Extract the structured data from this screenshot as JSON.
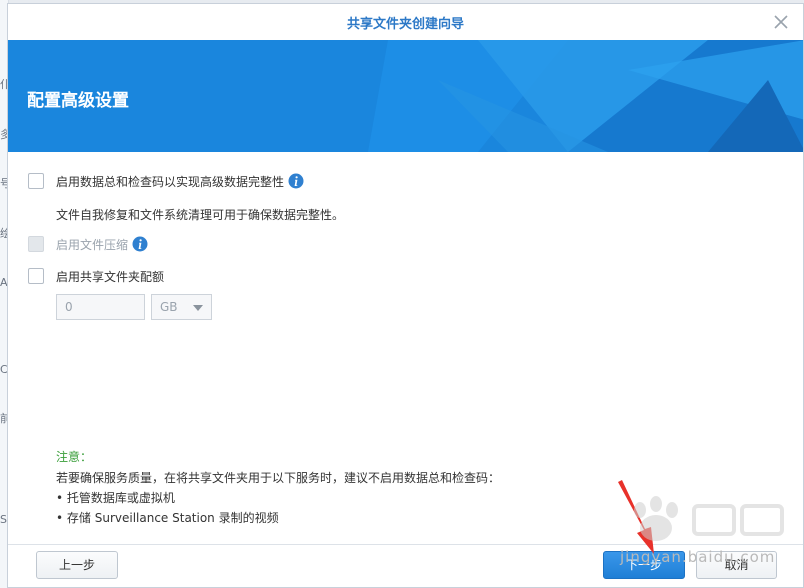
{
  "dialog": {
    "title": "共享文件夹创建向导",
    "heading": "配置高级设置"
  },
  "options": {
    "checksum": {
      "label": "启用数据总和检查码以实现高级数据完整性",
      "description": "文件自我修复和文件系统清理可用于确保数据完整性。",
      "checked": false,
      "enabled": true
    },
    "compression": {
      "label": "启用文件压缩",
      "checked": false,
      "enabled": false
    },
    "quota": {
      "label": "启用共享文件夹配额",
      "checked": false,
      "enabled": true,
      "value_placeholder": "0",
      "unit": "GB"
    }
  },
  "note": {
    "title": "注意：",
    "line1": "若要确保服务质量，在将共享文件夹用于以下服务时，建议不启用数据总和检查码：",
    "bullets": [
      "托管数据库或虚拟机",
      "存储 Surveillance Station 录制的视频"
    ]
  },
  "buttons": {
    "prev": "上一步",
    "next": "下一步",
    "cancel": "取消"
  },
  "background_glyphs": [
    "仆",
    "多",
    "号",
    "绘",
    "A",
    "C",
    "前",
    "S"
  ],
  "watermark": "jingyan.baidu.com",
  "colors": {
    "accent": "#1f7fd6",
    "banner": "#1a86dd",
    "title": "#2d79c7",
    "note": "#3a9e3a",
    "arrow": "#e8312a"
  },
  "icons": [
    "close-icon",
    "info-icon",
    "chevron-down-icon",
    "arrow-pointer-icon"
  ]
}
